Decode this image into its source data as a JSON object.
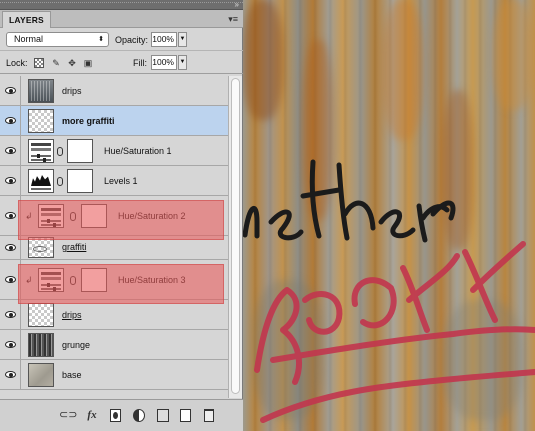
{
  "panel": {
    "tab": "LAYERS",
    "collapse_icon": "double-chevron-icon",
    "menu_icon": "panel-menu-icon",
    "blend_mode": "Normal",
    "opacity_label": "Opacity:",
    "opacity_value": "100%",
    "lock_label": "Lock:",
    "fill_label": "Fill:",
    "fill_value": "100%",
    "lock_icons": [
      "lock-transparent-icon",
      "lock-image-icon",
      "lock-position-icon",
      "lock-all-icon"
    ]
  },
  "layers": [
    {
      "name": "drips",
      "kind": "pixel",
      "thumb": "drips",
      "selected": false
    },
    {
      "name": "more graffiti",
      "kind": "pixel",
      "thumb": "transparent",
      "selected": true
    },
    {
      "name": "Hue/Saturation 1",
      "kind": "adjustment",
      "thumb": "hue-saturation",
      "selected": false
    },
    {
      "name": "Levels 1",
      "kind": "adjustment",
      "thumb": "levels",
      "selected": false
    },
    {
      "name": "Hue/Saturation 2",
      "kind": "adjustment",
      "thumb": "hue-saturation",
      "clipped": true,
      "highlighted": true
    },
    {
      "name": "graffiti",
      "kind": "pixel",
      "thumb": "transparent",
      "underlined": true
    },
    {
      "name": "Hue/Saturation 3",
      "kind": "adjustment",
      "thumb": "hue-saturation",
      "clipped": true,
      "highlighted": true
    },
    {
      "name": "drips",
      "kind": "pixel",
      "thumb": "transparent",
      "underlined": true
    },
    {
      "name": "grunge",
      "kind": "pixel",
      "thumb": "grunge"
    },
    {
      "name": "base",
      "kind": "pixel",
      "thumb": "base"
    }
  ],
  "bottom_bar": {
    "icons": [
      "link-layers-icon",
      "fx-icon",
      "add-mask-icon",
      "adjustment-icon",
      "group-icon",
      "new-layer-icon",
      "delete-icon"
    ],
    "fx_label": "fx"
  },
  "artwork": {
    "colors": {
      "rust": "#b8843e",
      "concrete": "#a19e95",
      "ink": "#1b1b1b",
      "red_paint": "#c2364e"
    }
  }
}
